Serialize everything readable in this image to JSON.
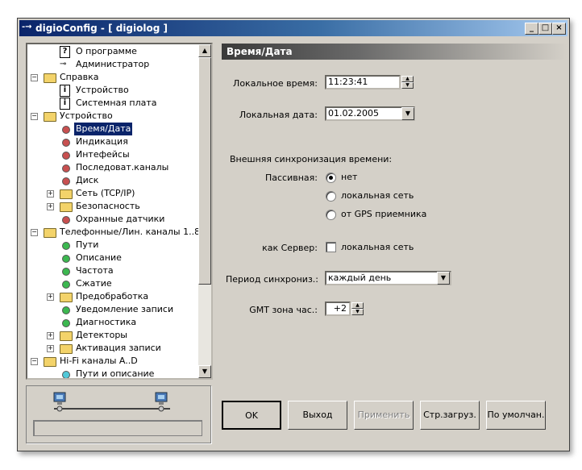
{
  "window": {
    "title": "digioConfig - [ digiolog ]",
    "app_glyph": "-→"
  },
  "titlebar_buttons": {
    "minimize": "_",
    "maximize": "□",
    "close": "×"
  },
  "tree": {
    "items": [
      {
        "label": "О программе",
        "icon": "question-icon",
        "level": 1,
        "expander": ""
      },
      {
        "label": "Администратор",
        "icon": "key-icon",
        "level": 1,
        "expander": ""
      },
      {
        "label": "Справка",
        "icon": "folder-icon",
        "level": 0,
        "expander": "−"
      },
      {
        "label": "Устройство",
        "icon": "info-icon",
        "level": 1,
        "expander": ""
      },
      {
        "label": "Системная плата",
        "icon": "info-icon",
        "level": 1,
        "expander": ""
      },
      {
        "label": "Устройство",
        "icon": "folder-icon",
        "level": 0,
        "expander": "−"
      },
      {
        "label": "Время/Дата",
        "icon": "red-dot-icon",
        "level": 1,
        "expander": "",
        "selected": true
      },
      {
        "label": "Индикация",
        "icon": "red-dot-icon",
        "level": 1,
        "expander": ""
      },
      {
        "label": "Интефейсы",
        "icon": "red-dot-icon",
        "level": 1,
        "expander": ""
      },
      {
        "label": "Последоват.каналы",
        "icon": "red-dot-icon",
        "level": 1,
        "expander": ""
      },
      {
        "label": "Диск",
        "icon": "red-dot-icon",
        "level": 1,
        "expander": ""
      },
      {
        "label": "Сеть (TCP/IP)",
        "icon": "folder-icon",
        "level": 1,
        "expander": "+"
      },
      {
        "label": "Безопасность",
        "icon": "folder-icon",
        "level": 1,
        "expander": "+"
      },
      {
        "label": "Охранные датчики",
        "icon": "red-dot-icon",
        "level": 1,
        "expander": ""
      },
      {
        "label": "Телефонные/Лин. каналы 1..8",
        "icon": "folder-icon",
        "level": 0,
        "expander": "−"
      },
      {
        "label": "Пути",
        "icon": "green-dot-icon",
        "level": 1,
        "expander": ""
      },
      {
        "label": "Описание",
        "icon": "green-dot-icon",
        "level": 1,
        "expander": ""
      },
      {
        "label": "Частота",
        "icon": "green-dot-icon",
        "level": 1,
        "expander": ""
      },
      {
        "label": "Сжатие",
        "icon": "green-dot-icon",
        "level": 1,
        "expander": ""
      },
      {
        "label": "Предобработка",
        "icon": "folder-icon",
        "level": 1,
        "expander": "+"
      },
      {
        "label": "Уведомление записи",
        "icon": "green-dot-icon",
        "level": 1,
        "expander": ""
      },
      {
        "label": "Диагностика",
        "icon": "green-dot-icon",
        "level": 1,
        "expander": ""
      },
      {
        "label": "Детекторы",
        "icon": "folder-icon",
        "level": 1,
        "expander": "+"
      },
      {
        "label": "Активация записи",
        "icon": "folder-icon",
        "level": 1,
        "expander": "+"
      },
      {
        "label": "Hi-Fi каналы A..D",
        "icon": "folder-icon",
        "level": 0,
        "expander": "−"
      },
      {
        "label": "Пути и описание",
        "icon": "cyan-dot-icon",
        "level": 1,
        "expander": ""
      }
    ]
  },
  "panel": {
    "header": "Время/Дата",
    "local_time_label": "Локальное время:",
    "local_time_value": "11:23:41",
    "local_date_label": "Локальная дата:",
    "local_date_value": "01.02.2005",
    "sync_title": "Внешняя синхронизация времени:",
    "passive_label": "Пассивная:",
    "passive_options": [
      "нет",
      "локальная сеть",
      "от GPS приемника"
    ],
    "passive_selected": "нет",
    "server_label": "как Сервер:",
    "server_option": "локальная сеть",
    "period_label": "Период синхрониз.:",
    "period_value": "каждый день",
    "gmt_label": "GMT зона час.:",
    "gmt_value": "+2"
  },
  "buttons": {
    "ok": "OK",
    "exit": "Выход",
    "apply": "Применить",
    "boot_page": "Стр.загруз.",
    "defaults": "По умолчан."
  },
  "colors": {
    "red_dot": "#c85050",
    "green_dot": "#3cb850",
    "cyan_dot": "#50c8d8",
    "selection": "#0a246a"
  }
}
